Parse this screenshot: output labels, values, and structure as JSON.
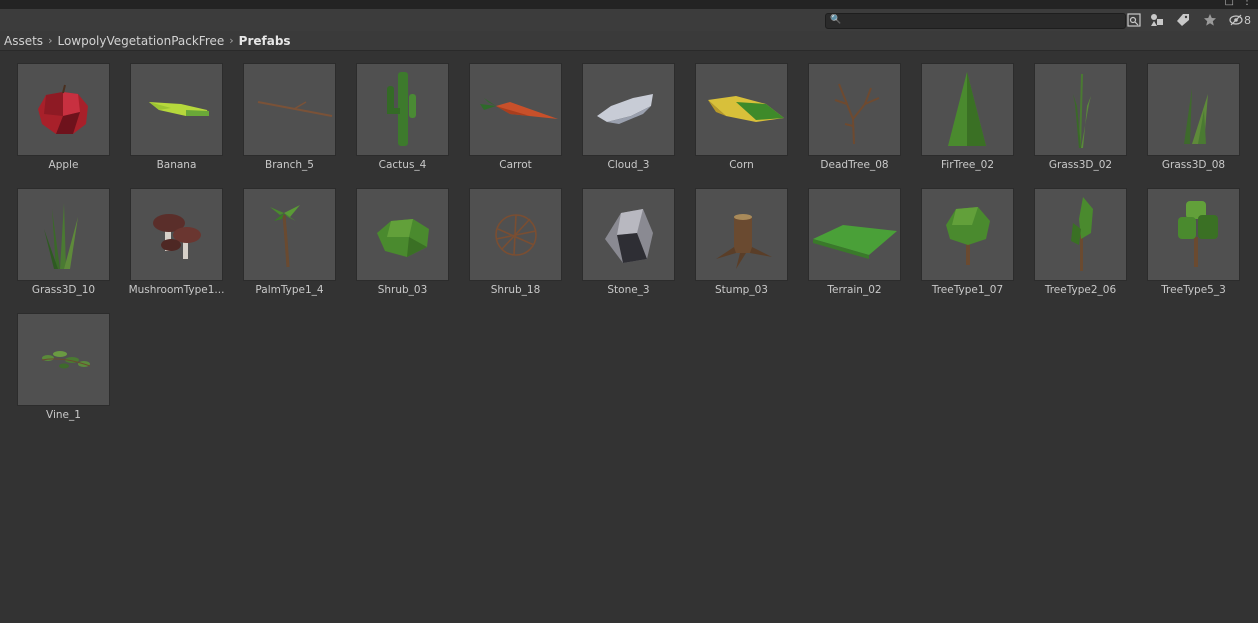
{
  "breadcrumb": {
    "items": [
      "Assets",
      "LowpolyVegetationPackFree"
    ],
    "current": "Prefabs"
  },
  "search": {
    "placeholder": ""
  },
  "toolbar": {
    "hidden_count": "8",
    "icons": [
      "search-by-type-icon",
      "label-filter-icon",
      "tag-icon",
      "favorite-star-icon",
      "hidden-eye-icon"
    ]
  },
  "assets": [
    {
      "name": "Apple",
      "icon": "apple-icon"
    },
    {
      "name": "Banana",
      "icon": "banana-icon"
    },
    {
      "name": "Branch_5",
      "icon": "branch-icon"
    },
    {
      "name": "Cactus_4",
      "icon": "cactus-icon"
    },
    {
      "name": "Carrot",
      "icon": "carrot-icon"
    },
    {
      "name": "Cloud_3",
      "icon": "cloud-icon"
    },
    {
      "name": "Corn",
      "icon": "corn-icon"
    },
    {
      "name": "DeadTree_08",
      "icon": "dead-tree-icon"
    },
    {
      "name": "FirTree_02",
      "icon": "fir-tree-icon"
    },
    {
      "name": "Grass3D_02",
      "icon": "grass-icon"
    },
    {
      "name": "Grass3D_08",
      "icon": "grass-icon"
    },
    {
      "name": "Grass3D_10",
      "icon": "grass-icon"
    },
    {
      "name": "MushroomType1...",
      "icon": "mushroom-icon"
    },
    {
      "name": "PalmType1_4",
      "icon": "palm-tree-icon"
    },
    {
      "name": "Shrub_03",
      "icon": "shrub-icon"
    },
    {
      "name": "Shrub_18",
      "icon": "dry-shrub-icon"
    },
    {
      "name": "Stone_3",
      "icon": "stone-icon"
    },
    {
      "name": "Stump_03",
      "icon": "stump-icon"
    },
    {
      "name": "Terrain_02",
      "icon": "terrain-icon"
    },
    {
      "name": "TreeType1_07",
      "icon": "tree-icon"
    },
    {
      "name": "TreeType2_06",
      "icon": "tall-tree-icon"
    },
    {
      "name": "TreeType5_3",
      "icon": "bushy-tree-icon"
    },
    {
      "name": "Vine_1",
      "icon": "vine-icon"
    }
  ]
}
